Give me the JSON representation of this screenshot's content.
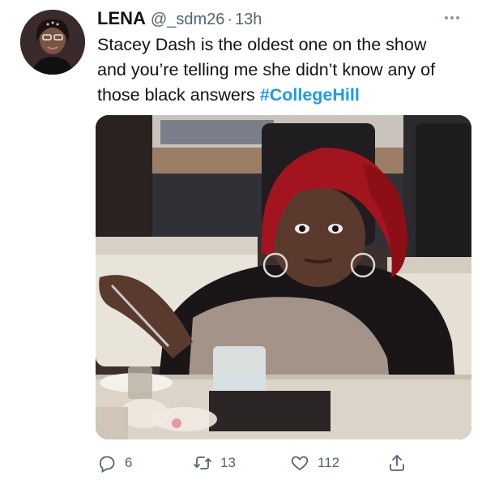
{
  "tweet": {
    "author": {
      "name": "LENA",
      "handle": "@_sdm26",
      "separator": "·",
      "time": "13h"
    },
    "text": {
      "line1": "Stacey Dash is the oldest one on the show",
      "line2": "and you’re telling me she didn’t know any of",
      "line3_prefix": "those black answers ",
      "hashtag": "#CollegeHill"
    },
    "actions": {
      "reply_count": "6",
      "retweet_count": "13",
      "like_count": "112"
    },
    "icons": {
      "more": "more-dots-icon",
      "reply": "reply-icon",
      "retweet": "retweet-icon",
      "like": "heart-icon",
      "share": "share-icon"
    },
    "colors": {
      "hashtag": "#1d9bf0",
      "secondary_text": "#536471",
      "primary_text": "#0f1419"
    }
  }
}
